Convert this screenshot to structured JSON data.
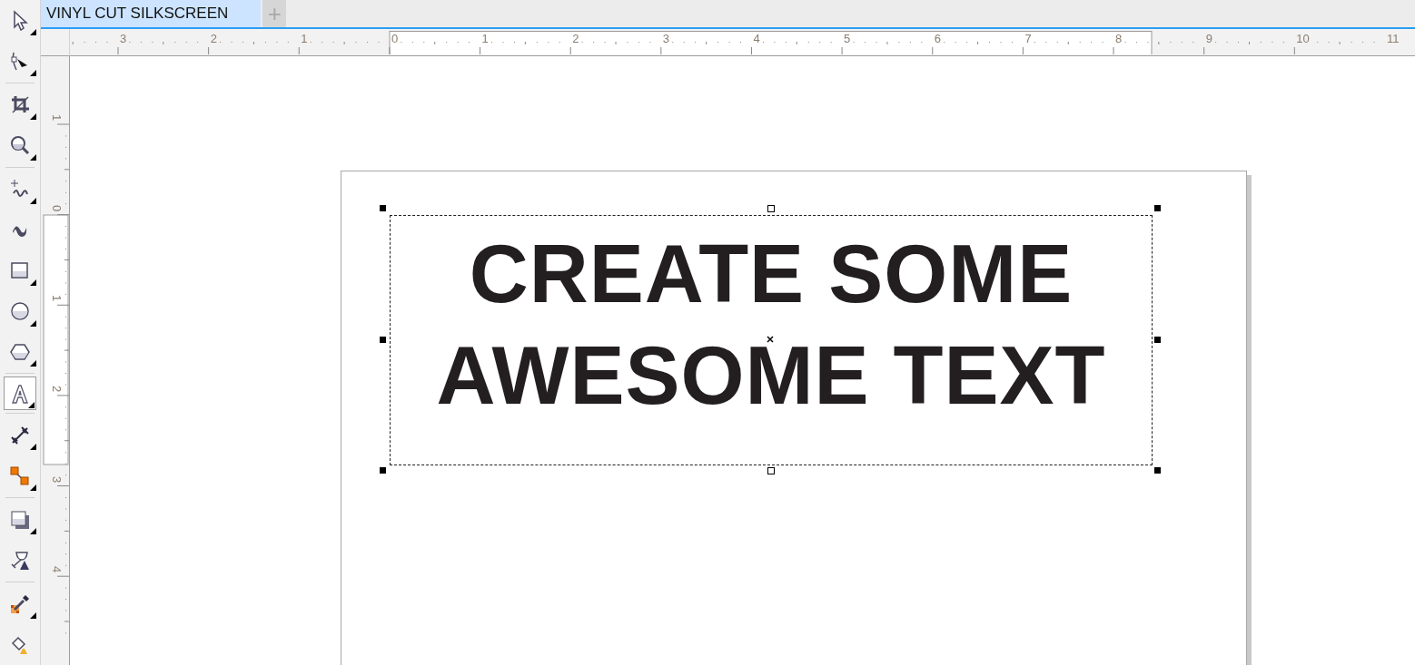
{
  "document_tabs": [
    {
      "label": "VINYL CUT SILKSCREEN",
      "selected": true
    }
  ],
  "new_tab_button": {
    "label": "+"
  },
  "toolbox": {
    "groups": [
      [
        {
          "kind": "pick",
          "flyout": true,
          "active": false
        },
        {
          "kind": "shape",
          "flyout": true,
          "active": false
        }
      ],
      [
        {
          "kind": "crop",
          "flyout": true,
          "active": false
        },
        {
          "kind": "zoom",
          "flyout": true,
          "active": false
        }
      ],
      [
        {
          "kind": "freehand",
          "flyout": true,
          "active": false
        },
        {
          "kind": "artistic",
          "flyout": false,
          "active": false
        },
        {
          "kind": "rectangle",
          "flyout": true,
          "active": false
        },
        {
          "kind": "ellipse",
          "flyout": true,
          "active": false
        },
        {
          "kind": "polygon",
          "flyout": true,
          "active": false
        }
      ],
      [
        {
          "kind": "text",
          "flyout": true,
          "active": true
        }
      ],
      [
        {
          "kind": "dimension",
          "flyout": true,
          "active": false
        },
        {
          "kind": "connector",
          "flyout": true,
          "active": false
        }
      ],
      [
        {
          "kind": "shadow",
          "flyout": true,
          "active": false
        },
        {
          "kind": "transparency",
          "flyout": false,
          "active": false
        }
      ],
      [
        {
          "kind": "eyedropper",
          "flyout": true,
          "active": false
        },
        {
          "kind": "fill",
          "flyout": false,
          "active": false
        }
      ]
    ]
  },
  "horizontal_ruler": {
    "labels": [
      "3",
      "2",
      "1",
      "0",
      "1",
      "2",
      "3",
      "4",
      "5",
      "6",
      "7",
      "8",
      "9",
      "10",
      "11"
    ]
  },
  "vertical_ruler": {
    "labels": [
      "1",
      "0",
      "1",
      "2",
      "3",
      "4"
    ]
  },
  "canvas": {
    "text_frame": {
      "selected": true,
      "lines": [
        "CREATE SOME",
        "AWESOME TEXT"
      ]
    }
  }
}
